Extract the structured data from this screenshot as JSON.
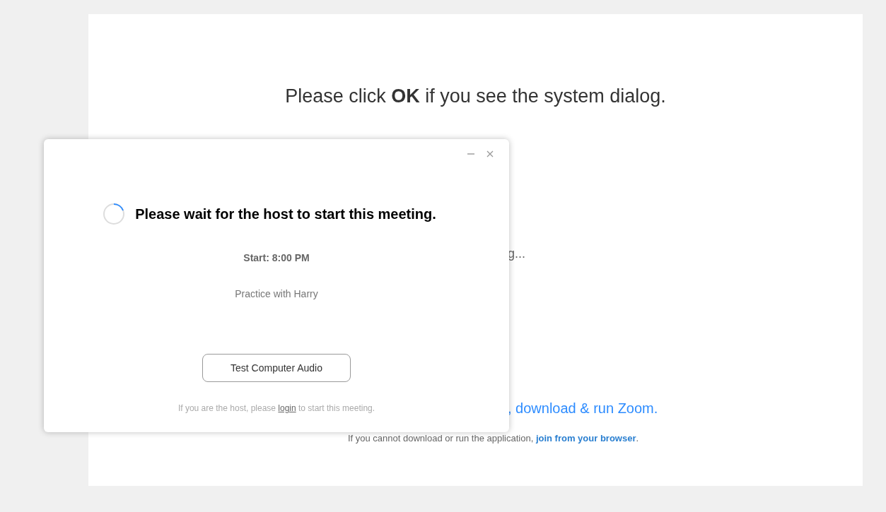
{
  "page": {
    "heading": "Please click **OK** if you see the system dialog.",
    "status_text": "g...",
    "download_text": ", download & run Zoom.",
    "fallback": {
      "before": "If you cannot download or run the application, ",
      "link": "join from your browser",
      "after": "."
    }
  },
  "dialog": {
    "title": "Please wait for the host to start this meeting.",
    "start": "Start: 8:00 PM",
    "topic": "Practice with Harry",
    "audio_button": "Test Computer Audio",
    "host_note": {
      "before": "If you are the host, please ",
      "link": "login",
      "after": " to start this meeting."
    }
  }
}
